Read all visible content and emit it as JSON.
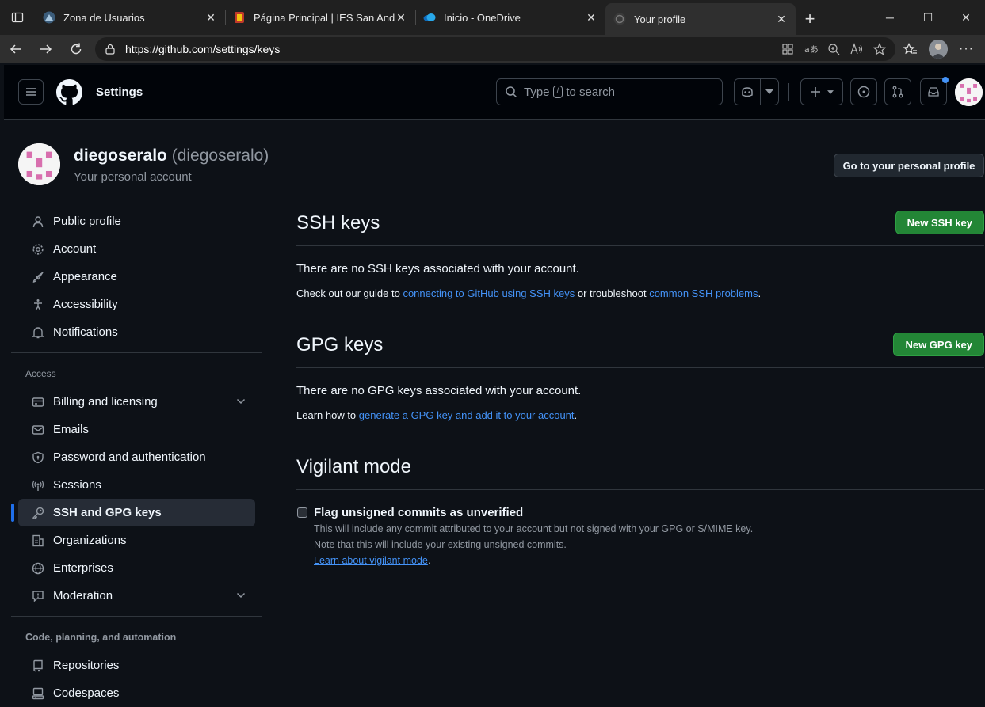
{
  "browser": {
    "tabs": [
      {
        "title": "Zona de Usuarios",
        "active": false
      },
      {
        "title": "Página Principal | IES San Andrés",
        "active": false
      },
      {
        "title": "Inicio - OneDrive",
        "active": false
      },
      {
        "title": "Your profile",
        "active": true
      }
    ],
    "url": "https://github.com/settings/keys"
  },
  "header": {
    "title": "Settings",
    "search_prefix": "Type",
    "search_key": "/",
    "search_suffix": "to search"
  },
  "profile": {
    "name": "diegoseralo",
    "login": "(diegoseralo)",
    "subtitle": "Your personal account",
    "goto_label": "Go to your personal profile"
  },
  "sidebar": {
    "items_top": [
      {
        "label": "Public profile",
        "icon": "person-icon"
      },
      {
        "label": "Account",
        "icon": "gear-icon"
      },
      {
        "label": "Appearance",
        "icon": "paintbrush-icon"
      },
      {
        "label": "Accessibility",
        "icon": "accessibility-icon"
      },
      {
        "label": "Notifications",
        "icon": "bell-icon"
      }
    ],
    "group_access": "Access",
    "items_access": [
      {
        "label": "Billing and licensing",
        "icon": "credit-card-icon"
      },
      {
        "label": "Emails",
        "icon": "mail-icon"
      },
      {
        "label": "Password and authentication",
        "icon": "shield-icon"
      },
      {
        "label": "Sessions",
        "icon": "broadcast-icon"
      },
      {
        "label": "SSH and GPG keys",
        "icon": "key-icon"
      },
      {
        "label": "Organizations",
        "icon": "organization-icon"
      },
      {
        "label": "Enterprises",
        "icon": "globe-icon"
      },
      {
        "label": "Moderation",
        "icon": "report-icon"
      }
    ],
    "group_code": "Code, planning, and automation",
    "items_code": [
      {
        "label": "Repositories",
        "icon": "repo-icon"
      },
      {
        "label": "Codespaces",
        "icon": "codespaces-icon"
      }
    ]
  },
  "ssh": {
    "title": "SSH keys",
    "button": "New SSH key",
    "empty": "There are no SSH keys associated with your account.",
    "help_prefix": "Check out our guide to",
    "link1": "connecting to GitHub using SSH keys",
    "help_middle": "or troubleshoot",
    "link2": "common SSH problems",
    "help_end": "."
  },
  "gpg": {
    "title": "GPG keys",
    "button": "New GPG key",
    "empty": "There are no GPG keys associated with your account.",
    "help_prefix": "Learn how to",
    "link": "generate a GPG key and add it to your account",
    "help_end": "."
  },
  "vigilant": {
    "title": "Vigilant mode",
    "checkbox_label": "Flag unsigned commits as unverified",
    "line1": "This will include any commit attributed to your account but not signed with your GPG or S/MIME key.",
    "line2": "Note that this will include your existing unsigned commits.",
    "link": "Learn about vigilant mode",
    "link_end": "."
  },
  "colors": {
    "accent_green": "#238636",
    "link_blue": "#4493f8",
    "selected_bar": "#1f6feb"
  }
}
